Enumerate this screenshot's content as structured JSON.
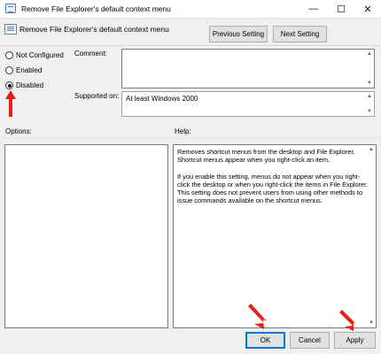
{
  "window": {
    "title": "Remove File Explorer's default context menu",
    "minimize_glyph": "—",
    "maximize_glyph": "☐",
    "close_glyph": "✕"
  },
  "header": {
    "policy_name": "Remove File Explorer's default context menu",
    "previous_label": "Previous Setting",
    "next_label": "Next Setting"
  },
  "state": {
    "options": [
      {
        "label": "Not Configured",
        "checked": false
      },
      {
        "label": "Enabled",
        "checked": false
      },
      {
        "label": "Disabled",
        "checked": true
      }
    ]
  },
  "comment": {
    "label": "Comment:",
    "value": ""
  },
  "supported": {
    "label": "Supported on:",
    "value": "At least Windows 2000"
  },
  "options_section": {
    "label": "Options:"
  },
  "help_section": {
    "label": "Help:",
    "paragraphs": [
      "Removes shortcut menus from the desktop and File Explorer. Shortcut menus appear when you right-click an item.",
      "If you enable this setting, menus do not appear when you right-click the desktop or when you right-click the items in File Explorer. This setting does not prevent users from using other methods to issue commands available on the shortcut menus."
    ]
  },
  "footer": {
    "ok_label": "OK",
    "cancel_label": "Cancel",
    "apply_label": "Apply"
  },
  "colors": {
    "annotation_arrow": "#e8201c",
    "focus_border": "#0078d7"
  }
}
